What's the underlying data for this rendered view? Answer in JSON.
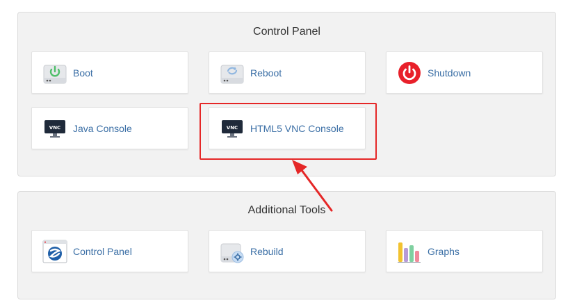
{
  "control_panel": {
    "title": "Control Panel",
    "tiles": [
      {
        "label": "Boot",
        "icon": "power-on-drive-icon"
      },
      {
        "label": "Reboot",
        "icon": "reboot-drive-icon"
      },
      {
        "label": "Shutdown",
        "icon": "shutdown-icon"
      },
      {
        "label": "Java Console",
        "icon": "vnc-monitor-icon",
        "badge": "VNC"
      },
      {
        "label": "HTML5 VNC Console",
        "icon": "vnc-monitor-icon",
        "badge": "VNC"
      }
    ]
  },
  "additional_tools": {
    "title": "Additional Tools",
    "tiles": [
      {
        "label": "Control Panel",
        "icon": "control-panel-window-icon"
      },
      {
        "label": "Rebuild",
        "icon": "rebuild-drive-icon"
      },
      {
        "label": "Graphs",
        "icon": "bar-graph-icon"
      }
    ]
  },
  "annotation": {
    "color": "#e52727"
  },
  "colors": {
    "link": "#3a6ea5",
    "panel_bg": "#f2f2f2",
    "shutdown_red": "#e8202a"
  }
}
